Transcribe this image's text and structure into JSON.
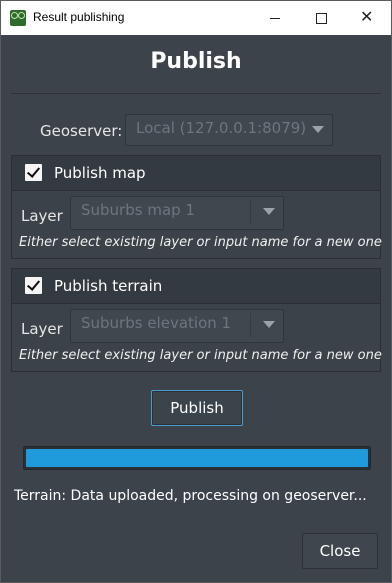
{
  "window": {
    "title": "Result publishing",
    "close_glyph": "✕"
  },
  "header": {
    "title": "Publish"
  },
  "geoserver": {
    "label": "Geoserver:",
    "selected": "Local (127.0.0.1:8079)"
  },
  "map_section": {
    "checked": true,
    "title": "Publish map",
    "layer_label": "Layer",
    "layer_value": "Suburbs map 1",
    "hint": "Either select existing layer or input name for a new one"
  },
  "terrain_section": {
    "checked": true,
    "title": "Publish terrain",
    "layer_label": "Layer",
    "layer_value": "Suburbs elevation 1",
    "hint": "Either select existing layer or input name for a new one"
  },
  "actions": {
    "publish_label": "Publish",
    "close_label": "Close"
  },
  "progress": {
    "value": 1.0,
    "color": "#1f9bdb"
  },
  "status": {
    "text": "Terrain: Data uploaded, processing on geoserver..."
  },
  "icons": {
    "app": "app-logo-icon",
    "minimize": "minimize-icon",
    "maximize": "maximize-icon",
    "close": "close-icon",
    "dropdown": "chevron-down-icon",
    "check": "checkmark-icon"
  }
}
